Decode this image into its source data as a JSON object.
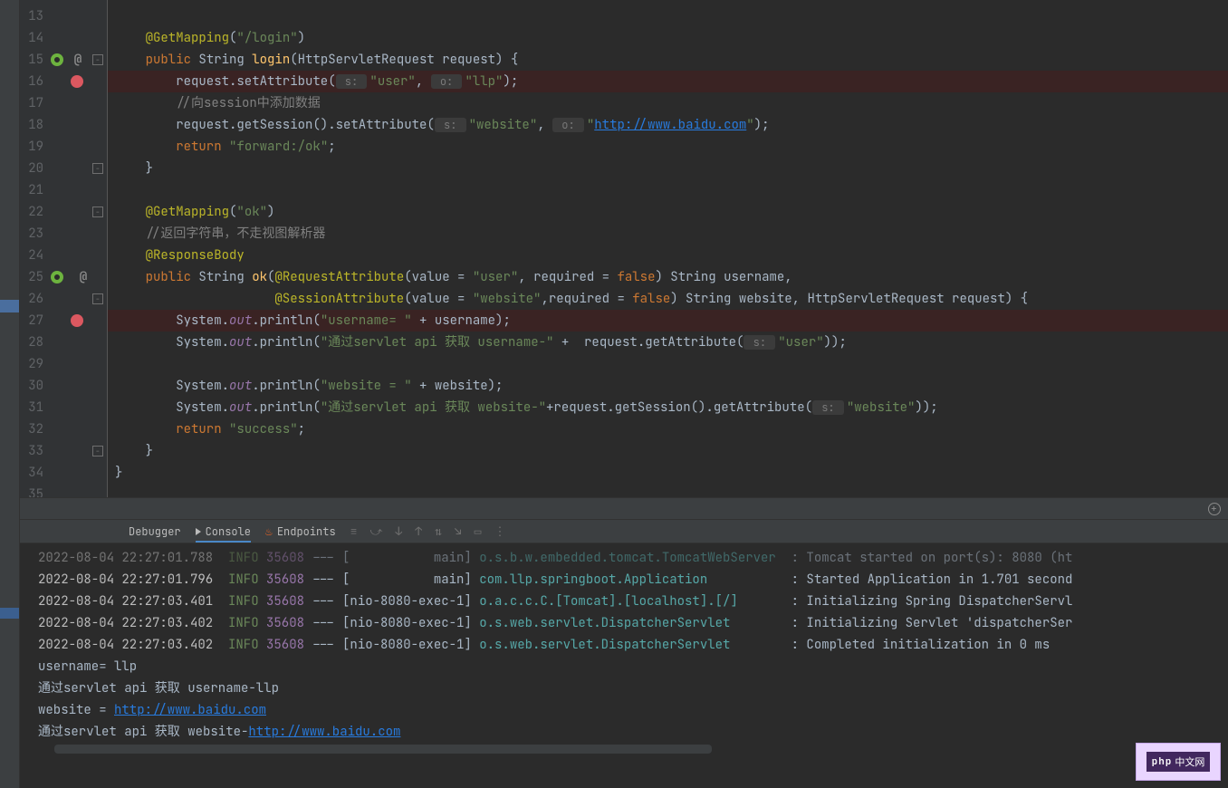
{
  "lines": [
    13,
    14,
    15,
    16,
    17,
    18,
    19,
    20,
    21,
    22,
    23,
    24,
    25,
    26,
    27,
    28,
    29,
    30,
    31,
    32,
    33,
    34,
    35
  ],
  "code": {
    "l14": {
      "ann": "@GetMapping",
      "p1": "(",
      "s1": "\"/login\"",
      "p2": ")"
    },
    "l15": {
      "kw": "public",
      "t1": " String ",
      "m": "login",
      "p1": "(",
      "t2": "HttpServletRequest request",
      "p2": ")",
      "p3": " {"
    },
    "l16": {
      "t1": "request.setAttribute(",
      "h1": " s: ",
      "s1": "\"user\"",
      "c1": ", ",
      "h2": " o: ",
      "s2": "\"llp\"",
      "t2": ");"
    },
    "l17": {
      "cmt": "//向session中添加数据"
    },
    "l18": {
      "t1": "request.getSession().setAttribute(",
      "h1": " s: ",
      "s1": "\"website\"",
      "c1": ", ",
      "h2": " o: ",
      "s2": "\"",
      "lk": "http://www.baidu.com",
      "s3": "\"",
      "t2": ");"
    },
    "l19": {
      "kw": "return ",
      "s1": "\"forward:/ok\"",
      "t1": ";"
    },
    "l20": {
      "t1": "}"
    },
    "l22": {
      "ann": "@GetMapping",
      "p1": "(",
      "s1": "\"ok\"",
      "p2": ")"
    },
    "l23": {
      "cmt": "//返回字符串，不走视图解析器"
    },
    "l24": {
      "ann": "@ResponseBody"
    },
    "l25": {
      "kw": "public",
      "t1": " String ",
      "m": "ok",
      "p1": "(",
      "ann2": "@RequestAttribute",
      "p2": "(",
      "t2": "value = ",
      "s1": "\"user\"",
      "c1": ", ",
      "t3": "required = ",
      "kw2": "false",
      "p3": ")",
      "t4": " String username,"
    },
    "l26": {
      "ann": "@SessionAttribute",
      "p1": "(",
      "t1": "value = ",
      "s1": "\"website\"",
      "c1": ",",
      "t2": "required = ",
      "kw": "false",
      "p2": ")",
      "t3": " String website, HttpServletRequest request) {"
    },
    "l27": {
      "t1": "System.",
      "st": "out",
      "t2": ".println(",
      "s1": "\"username= \"",
      "t3": " + username);"
    },
    "l28": {
      "t1": "System.",
      "st": "out",
      "t2": ".println(",
      "s1": "\"通过servlet api 获取 username-\"",
      "t3": " +  request.getAttribute(",
      "h1": " s: ",
      "s2": "\"user\"",
      "t4": "));"
    },
    "l30": {
      "t1": "System.",
      "st": "out",
      "t2": ".println(",
      "s1": "\"website = \"",
      "t3": " + website);"
    },
    "l31": {
      "t1": "System.",
      "st": "out",
      "t2": ".println(",
      "s1": "\"通过servlet api 获取 website-\"",
      "t3": "+request.getSession().getAttribute(",
      "h1": " s: ",
      "s2": "\"website\"",
      "t4": "));"
    },
    "l32": {
      "kw": "return ",
      "s1": "\"success\"",
      "t1": ";"
    },
    "l33": {
      "t1": "}"
    },
    "l34": {
      "t1": "}"
    }
  },
  "tabs": {
    "debugger": "Debugger",
    "console": "Console",
    "endpoints": "Endpoints"
  },
  "console": {
    "r0": {
      "ts": "2022-08-04 22:27:01.788  ",
      "inf": "INFO",
      "pid": " 35608",
      "th": " --- [           main] ",
      "lg": "o.s.b.w.embedded.tomcat.TomcatWebServer ",
      "msg": " : Tomcat started on port(s): 8080 (ht"
    },
    "r1": {
      "ts": "2022-08-04 22:27:01.796  ",
      "inf": "INFO",
      "pid": " 35608",
      "th": " --- [           main] ",
      "lg": "com.llp.springboot.Application          ",
      "msg": " : Started Application in 1.701 second"
    },
    "r2": {
      "ts": "2022-08-04 22:27:03.401  ",
      "inf": "INFO",
      "pid": " 35608",
      "th": " --- [nio-8080-exec-1] ",
      "lg": "o.a.c.c.C.[Tomcat].[localhost].[/]      ",
      "msg": " : Initializing Spring DispatcherServl"
    },
    "r3": {
      "ts": "2022-08-04 22:27:03.402  ",
      "inf": "INFO",
      "pid": " 35608",
      "th": " --- [nio-8080-exec-1] ",
      "lg": "o.s.web.servlet.DispatcherServlet       ",
      "msg": " : Initializing Servlet 'dispatcherSer"
    },
    "r4": {
      "ts": "2022-08-04 22:27:03.402  ",
      "inf": "INFO",
      "pid": " 35608",
      "th": " --- [nio-8080-exec-1] ",
      "lg": "o.s.web.servlet.DispatcherServlet       ",
      "msg": " : Completed initialization in 0 ms"
    },
    "r5": "username= llp",
    "r6": "通过servlet api 获取 username-llp",
    "r7_pre": "website = ",
    "r7_lk": "http://www.baidu.com",
    "r8_pre": "通过servlet api 获取 website-",
    "r8_lk": "http://www.baidu.com"
  },
  "badge": {
    "php": "php",
    "cn": "中文网"
  }
}
